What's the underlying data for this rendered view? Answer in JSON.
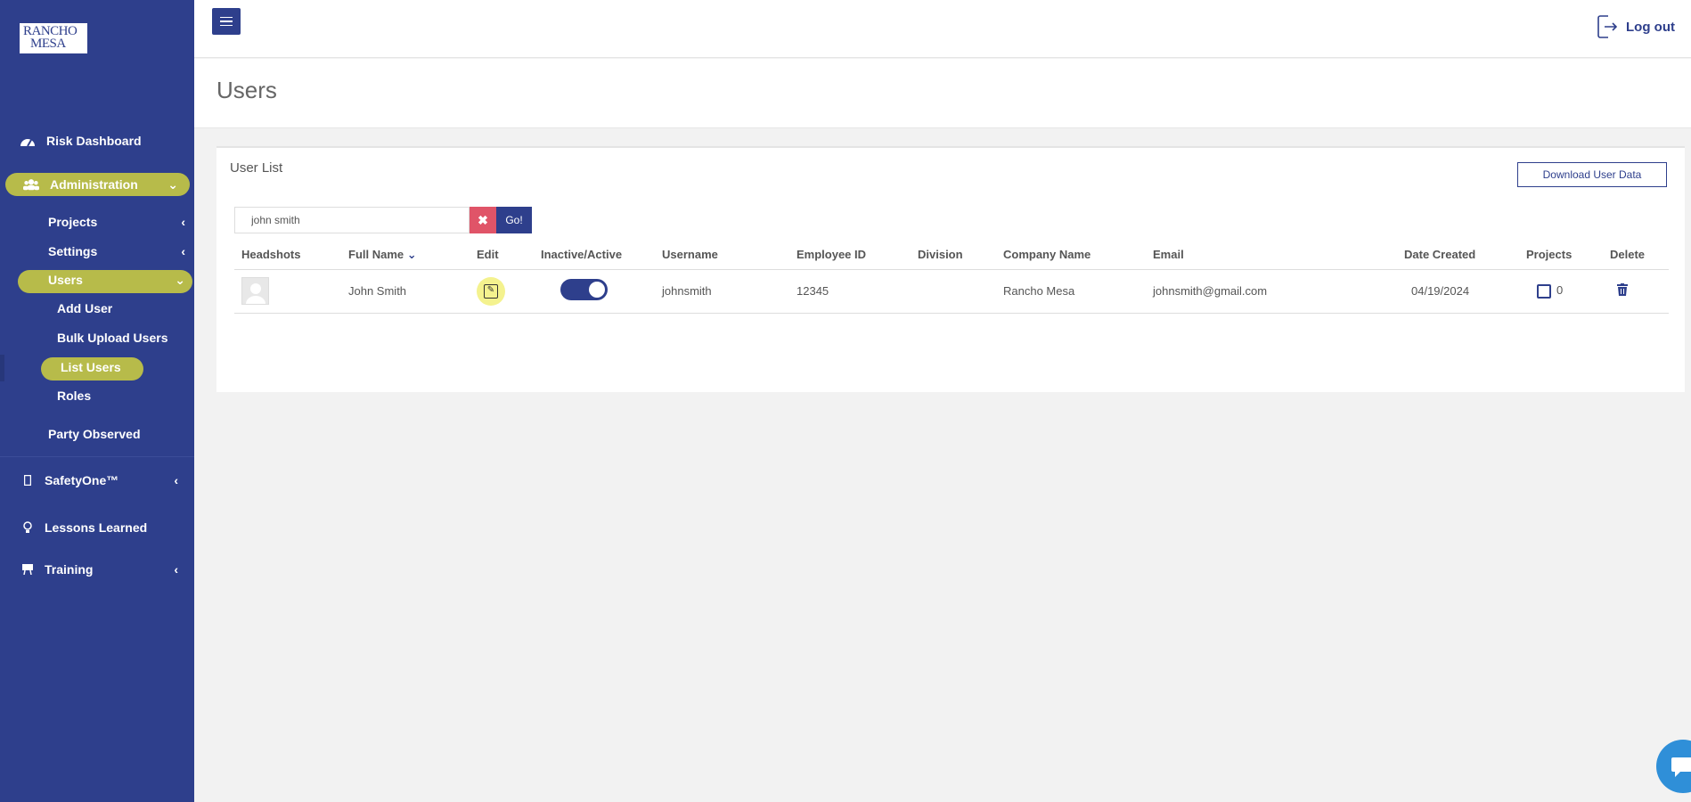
{
  "app": {
    "logo_line1": "RANCHO",
    "logo_line2": "MESA"
  },
  "sidebar": {
    "items": [
      {
        "label": "Risk Dashboard",
        "icon": "dashboard-icon"
      },
      {
        "label": "Administration",
        "icon": "users-group-icon"
      },
      {
        "label": "SafetyOne™",
        "icon": "mobile-icon"
      },
      {
        "label": "Lessons Learned",
        "icon": "lightbulb-icon"
      },
      {
        "label": "Training",
        "icon": "easel-icon"
      }
    ],
    "admin_sub": [
      {
        "label": "Projects"
      },
      {
        "label": "Settings"
      },
      {
        "label": "Users"
      },
      {
        "label": "Party Observed"
      }
    ],
    "users_sub": [
      {
        "label": "Add User"
      },
      {
        "label": "Bulk Upload Users"
      },
      {
        "label": "List Users"
      },
      {
        "label": "Roles"
      }
    ]
  },
  "topbar": {
    "logout_label": "Log out"
  },
  "page": {
    "title": "Users"
  },
  "card": {
    "title": "User List",
    "download_label": "Download User Data",
    "search_value": "john smith",
    "clear_icon": "✖",
    "go_label": "Go!"
  },
  "table": {
    "columns": [
      "Headshots",
      "Full Name",
      "Edit",
      "Inactive/Active",
      "Username",
      "Employee ID",
      "Division",
      "Company Name",
      "Email",
      "Date Created",
      "Projects",
      "Delete"
    ],
    "rows": [
      {
        "full_name": "John Smith",
        "active": true,
        "username": "johnsmith",
        "employee_id": "12345",
        "division": "",
        "company": "Rancho Mesa",
        "email": "johnsmith@gmail.com",
        "date_created": "04/19/2024",
        "projects": "0"
      }
    ]
  },
  "colors": {
    "sidebar": "#2e3f8c",
    "highlight": "#cfd13e",
    "danger": "#e05468",
    "chat": "#2f8fd8"
  }
}
